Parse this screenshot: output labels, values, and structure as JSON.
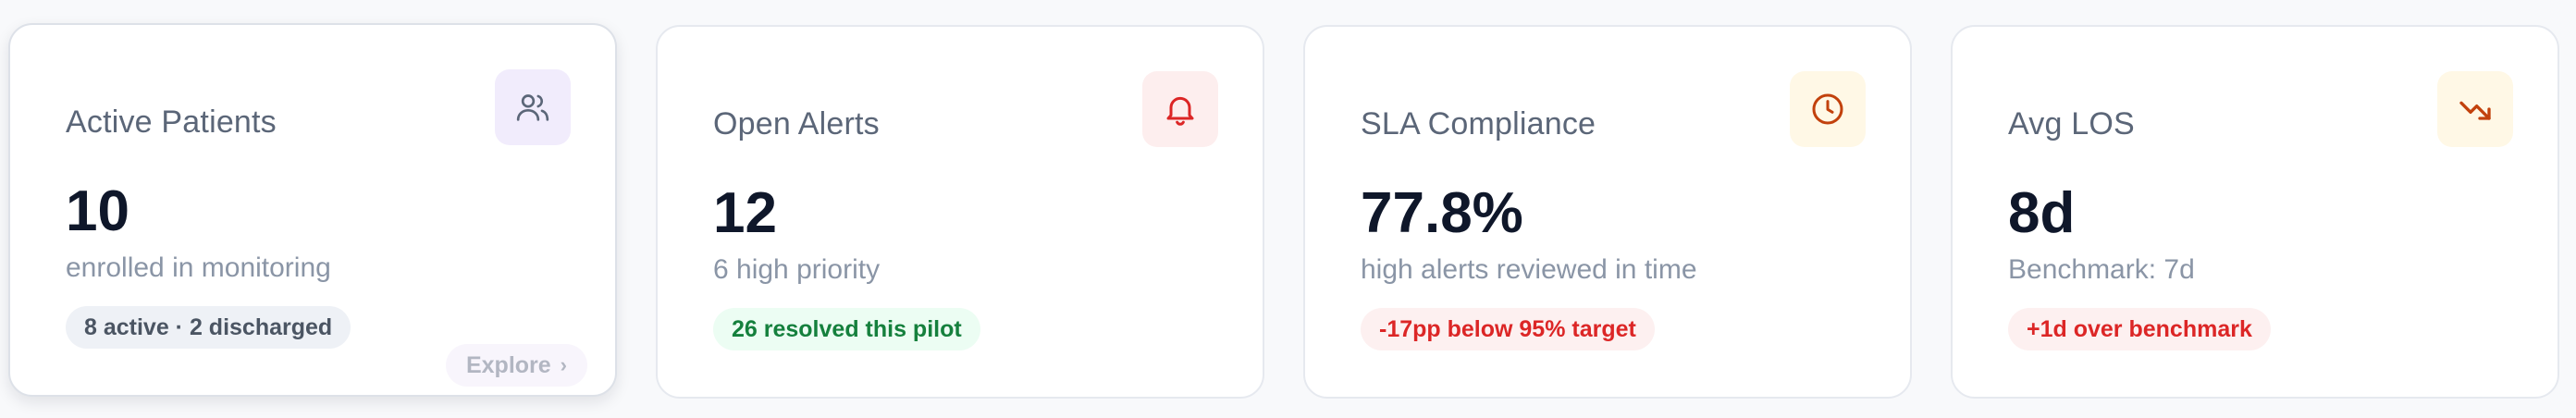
{
  "cards": [
    {
      "title": "Active Patients",
      "icon": "users-icon",
      "metric": "10",
      "subtitle": "enrolled in monitoring",
      "pill": "8 active · 2 discharged",
      "explore": "Explore",
      "colors": {
        "icon_bg": "#f1ecfc",
        "icon_fg": "#5b6678",
        "pill_bg": "#eef1f6",
        "pill_fg": "#4b5563"
      }
    },
    {
      "title": "Open Alerts",
      "icon": "bell-icon",
      "metric": "12",
      "subtitle": "6 high priority",
      "pill": "26 resolved this pilot",
      "colors": {
        "icon_bg": "#fdeeee",
        "icon_fg": "#dc2626",
        "pill_bg": "#ecfdf3",
        "pill_fg": "#15803d"
      }
    },
    {
      "title": "SLA Compliance",
      "icon": "clock-icon",
      "metric": "77.8%",
      "subtitle": "high alerts reviewed in time",
      "pill": "-17pp below 95% target",
      "colors": {
        "icon_bg": "#fff8e6",
        "icon_fg": "#c2410c",
        "pill_bg": "#fdf0f0",
        "pill_fg": "#dc2626"
      }
    },
    {
      "title": "Avg LOS",
      "icon": "trending-down-icon",
      "metric": "8d",
      "subtitle": "Benchmark: 7d",
      "pill": "+1d over benchmark",
      "colors": {
        "icon_bg": "#fff8e6",
        "icon_fg": "#c2410c",
        "pill_bg": "#fdf0f0",
        "pill_fg": "#dc2626"
      }
    }
  ]
}
